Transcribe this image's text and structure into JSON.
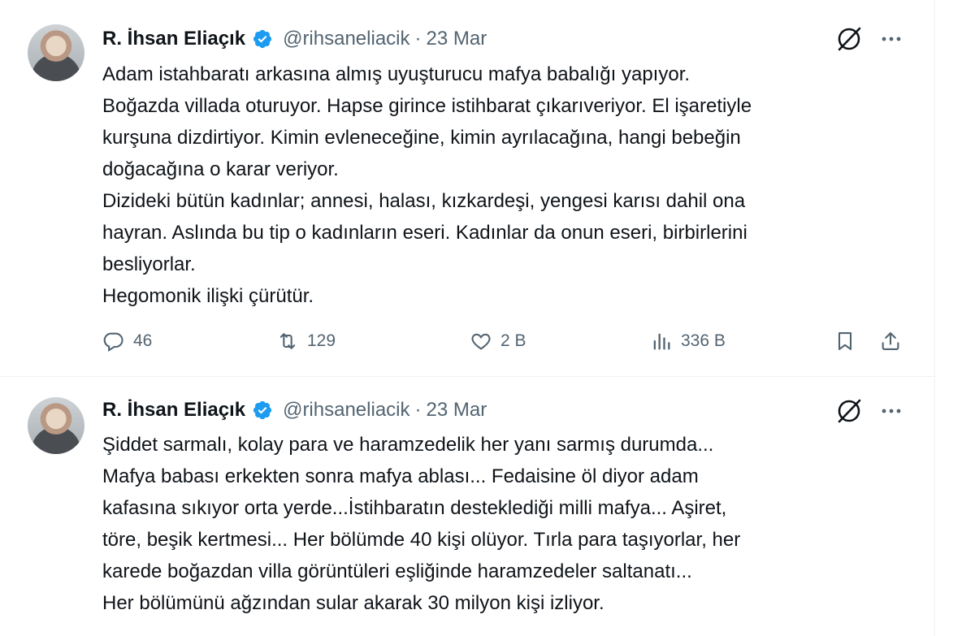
{
  "colors": {
    "text": "#0f1419",
    "muted": "#536471",
    "verified": "#1d9bf0",
    "border": "#eff3f4"
  },
  "tweets": [
    {
      "author": {
        "name": "R. İhsan Eliaçık",
        "handle": "@rihsaneliacik",
        "verified_icon": "verified-badge-icon"
      },
      "date": "23 Mar",
      "text_lines": [
        "Adam istahbaratı arkasına almış uyuşturucu mafya babalığı yapıyor.",
        "Boğazda villada oturuyor. Hapse girince istihbarat çıkarıveriyor. El işaretiyle",
        "kurşuna dizdirtiyor. Kimin evleneceğine, kimin ayrılacağına, hangi bebeğin",
        "doğacağına o karar veriyor.",
        "Dizideki bütün kadınlar; annesi, halası, kızkardeşi, yengesi karısı dahil ona",
        "hayran. Aslında bu tip o kadınların eseri. Kadınlar da onun eseri, birbirlerini",
        "besliyorlar.",
        "Hegomonik ilişki çürütür."
      ],
      "stats": {
        "replies": "46",
        "retweets": "129",
        "likes": "2 B",
        "views": "336 B"
      }
    },
    {
      "author": {
        "name": "R. İhsan Eliaçık",
        "handle": "@rihsaneliacik",
        "verified_icon": "verified-badge-icon"
      },
      "date": "23 Mar",
      "text_lines": [
        "Şiddet sarmalı, kolay para ve haramzedelik her yanı sarmış durumda...",
        "Mafya babası erkekten sonra mafya ablası... Fedaisine öl diyor adam",
        "kafasına sıkıyor orta yerde...İstihbaratın desteklediği milli mafya... Aşiret,",
        "töre, beşik kertmesi... Her bölümde 40 kişi olüyor. Tırla para taşıyorlar, her",
        "karede boğazdan villa görüntüleri eşliğinde haramzedeler saltanatı...",
        "Her bölümünü ağzından sular akarak 30 milyon kişi izliyor."
      ]
    }
  ],
  "separator": "·"
}
